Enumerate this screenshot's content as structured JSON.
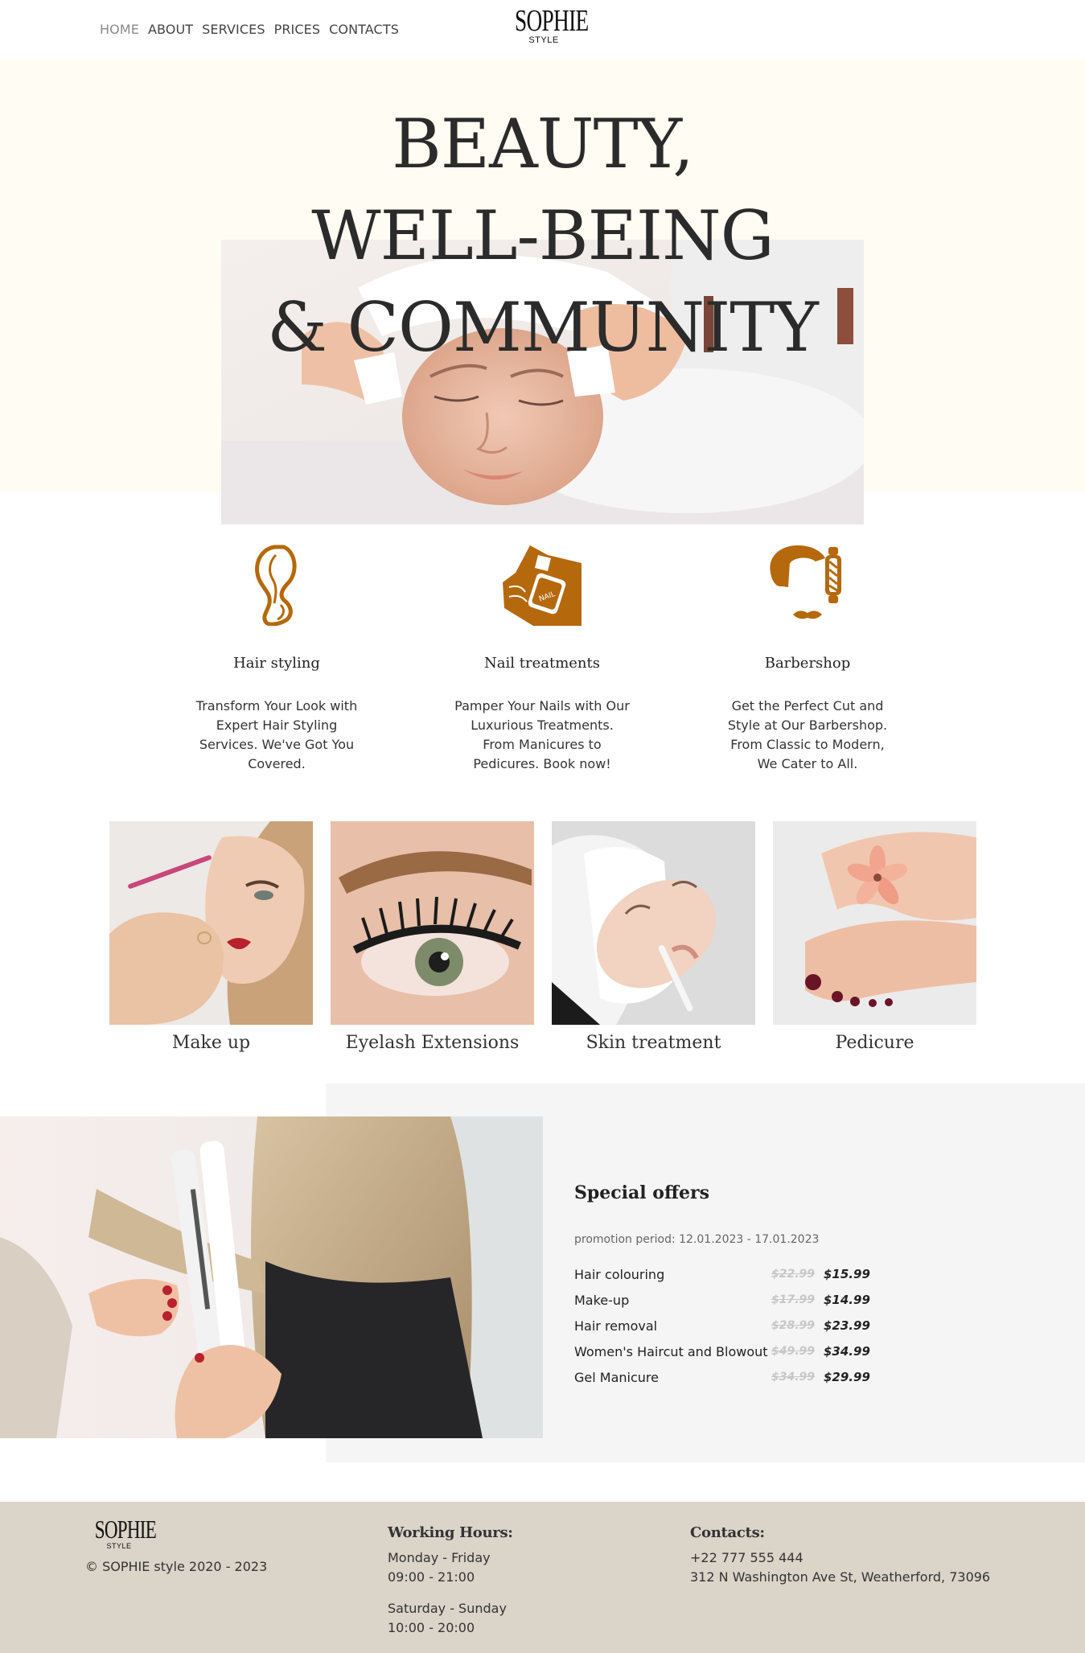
{
  "nav": {
    "items": [
      "HOME",
      "ABOUT",
      "SERVICES",
      "PRICES",
      "CONTACTS"
    ],
    "active": "HOME"
  },
  "logo": {
    "main": "SOPHIE",
    "sub": "STYLE"
  },
  "hero": {
    "lines": [
      "BEAUTY,",
      "WELL-BEING",
      "& COMMUNITY"
    ]
  },
  "services": [
    {
      "title": "Hair styling",
      "text": "Transform Your Look with Expert Hair Styling Services. We've Got You Covered.",
      "icon": "hair-styling-icon"
    },
    {
      "title": "Nail treatments",
      "text": "Pamper Your Nails with Our Luxurious Treatments. From Manicures to Pedicures. Book now!",
      "icon": "nail-polish-icon"
    },
    {
      "title": "Barbershop",
      "text": "Get the Perfect Cut and Style at Our Barbershop. From Classic to Modern, We Cater to All.",
      "icon": "barber-pole-icon"
    }
  ],
  "gallery": [
    {
      "caption": "Make up"
    },
    {
      "caption": "Eyelash Extensions"
    },
    {
      "caption": "Skin treatment"
    },
    {
      "caption": "Pedicure"
    }
  ],
  "offers": {
    "title": "Special offers",
    "period": "promotion period: 12.01.2023 - 17.01.2023",
    "items": [
      {
        "name": "Hair colouring",
        "old": "$22.99",
        "new": "$15.99"
      },
      {
        "name": "Make-up",
        "old": "$17.99",
        "new": "$14.99"
      },
      {
        "name": "Hair removal",
        "old": "$28.99",
        "new": "$23.99"
      },
      {
        "name": "Women's Haircut and Blowout",
        "old": "$49.99",
        "new": "$34.99"
      },
      {
        "name": "Gel Manicure",
        "old": "$34.99",
        "new": "$29.99"
      }
    ]
  },
  "footer": {
    "copyright": "© SOPHIE style 2020 - 2023",
    "hours": {
      "title": "Working Hours:",
      "weekdays_label": "Monday - Friday",
      "weekdays_time": "09:00 - 21:00",
      "weekend_label": "Saturday - Sunday",
      "weekend_time": "10:00 - 20:00"
    },
    "contacts": {
      "title": "Contacts:",
      "phone": "+22 777 555 444",
      "address": "312 N Washington Ave St, Weatherford, 73096"
    }
  },
  "colors": {
    "accent": "#b5690c",
    "hero_bg": "#fffdf3",
    "offers_bg": "#f5f5f5",
    "footer_bg": "#dad4c9",
    "text": "#333333"
  }
}
